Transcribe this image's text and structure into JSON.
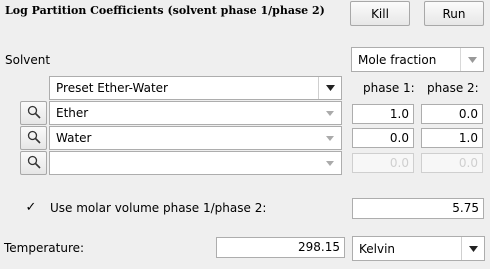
{
  "title": "Log Partition Coefficients (solvent phase 1/phase 2)",
  "buttons": {
    "kill": "Kill",
    "run": "Run"
  },
  "solvent": {
    "label": "Solvent",
    "mode": "Mole fraction"
  },
  "preset": "Preset Ether-Water",
  "headers": {
    "phase1": "phase 1:",
    "phase2": "phase 2:"
  },
  "rows": [
    {
      "name": "Ether",
      "phase1": "1.0",
      "phase2": "0.0"
    },
    {
      "name": "Water",
      "phase1": "0.0",
      "phase2": "1.0"
    },
    {
      "name": "",
      "phase1": "0.0",
      "phase2": "0.0"
    }
  ],
  "molar_volume": {
    "checked_glyph": "✓",
    "label": "Use molar volume phase 1/phase 2:",
    "value": "5.75"
  },
  "temperature": {
    "label": "Temperature:",
    "value": "298.15",
    "unit": "Kelvin"
  },
  "icons": {
    "search": "magnifier-icon",
    "dropdown": "chevron-down-icon"
  }
}
